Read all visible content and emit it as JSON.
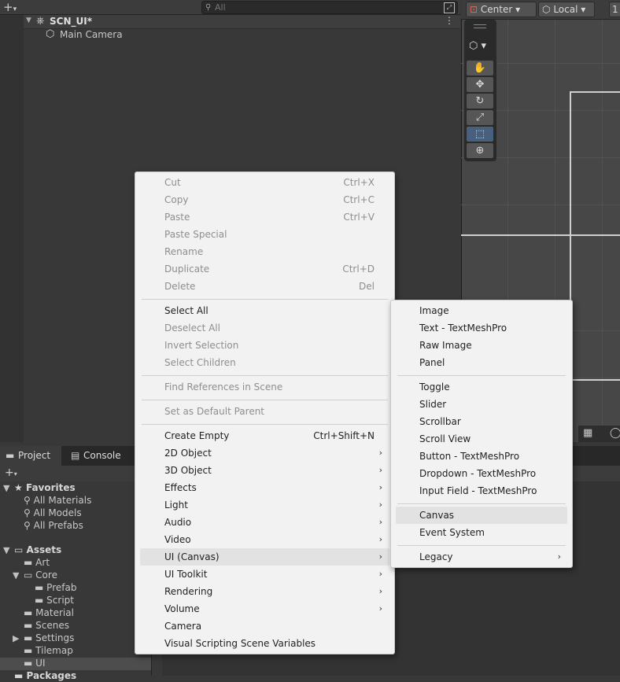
{
  "hierarchy": {
    "search_placeholder": "All",
    "scene_name": "SCN_UI*",
    "camera_name": "Main Camera"
  },
  "scene_view": {
    "pivot": "Center",
    "space": "Local",
    "extra": "1"
  },
  "project": {
    "tabs": [
      {
        "label": "Project"
      },
      {
        "label": "Console"
      }
    ],
    "favorites": {
      "label": "Favorites",
      "items": [
        "All Materials",
        "All Models",
        "All Prefabs"
      ]
    },
    "assets": {
      "label": "Assets",
      "items": [
        "Art",
        "Core",
        "Prefab",
        "Script",
        "Material",
        "Scenes",
        "Settings",
        "Tilemap",
        "UI"
      ]
    },
    "packages_label": "Packages"
  },
  "context_menu": {
    "edit": [
      {
        "label": "Cut",
        "shortcut": "Ctrl+X"
      },
      {
        "label": "Copy",
        "shortcut": "Ctrl+C"
      },
      {
        "label": "Paste",
        "shortcut": "Ctrl+V"
      },
      {
        "label": "Paste Special",
        "shortcut": ""
      },
      {
        "label": "Rename",
        "shortcut": ""
      },
      {
        "label": "Duplicate",
        "shortcut": "Ctrl+D"
      },
      {
        "label": "Delete",
        "shortcut": "Del"
      }
    ],
    "select": [
      "Select All",
      "Deselect All",
      "Invert Selection",
      "Select Children"
    ],
    "find_refs": "Find References in Scene",
    "set_default": "Set as Default Parent",
    "create_empty": {
      "label": "Create Empty",
      "shortcut": "Ctrl+Shift+N"
    },
    "submenus": [
      "2D Object",
      "3D Object",
      "Effects",
      "Light",
      "Audio",
      "Video",
      "UI (Canvas)",
      "UI Toolkit",
      "Rendering",
      "Volume"
    ],
    "camera": "Camera",
    "vs_vars": "Visual Scripting Scene Variables"
  },
  "ui_submenu": {
    "group1": [
      "Image",
      "Text - TextMeshPro",
      "Raw Image",
      "Panel"
    ],
    "group2": [
      "Toggle",
      "Slider",
      "Scrollbar",
      "Scroll View",
      "Button - TextMeshPro",
      "Dropdown - TextMeshPro",
      "Input Field - TextMeshPro"
    ],
    "group3": [
      "Canvas",
      "Event System"
    ],
    "legacy": "Legacy"
  }
}
